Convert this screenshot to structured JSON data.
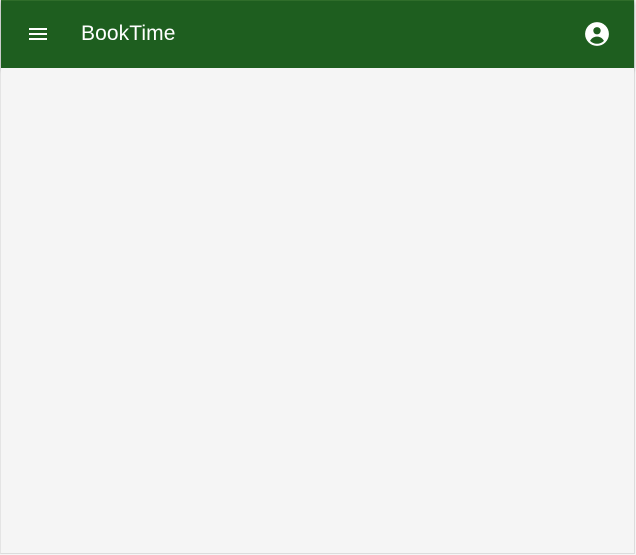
{
  "app_bar": {
    "title": "BookTime",
    "background_color": "#1e5e1f",
    "text_color": "#ffffff",
    "menu_icon": "menu-icon",
    "account_icon": "account-circle-icon"
  },
  "content": {
    "background_color": "#f5f5f5"
  }
}
